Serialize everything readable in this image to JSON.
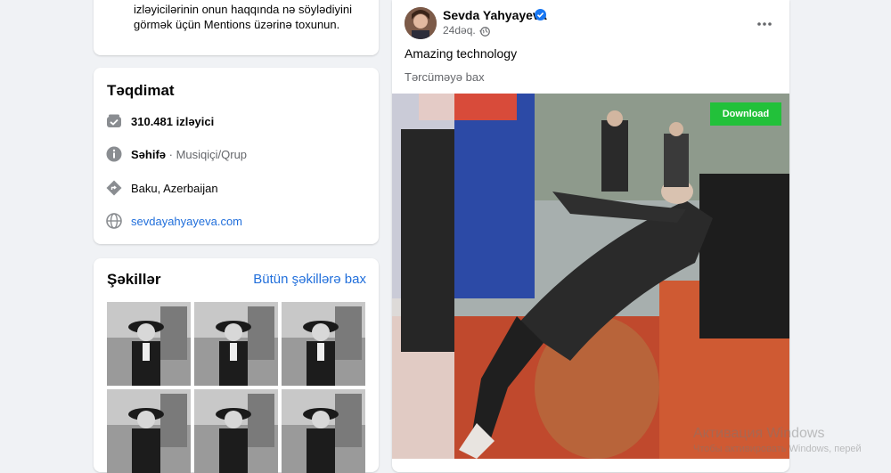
{
  "mentions": {
    "text": "izləyicilərinin onun haqqında nə söylədiyini görmək üçün Mentions üzərinə toxunun."
  },
  "intro": {
    "title": "Təqdimat",
    "followers": "310.481 izləyici",
    "page_label": "Səhifə",
    "page_category": " · Musiqiçi/Qrup",
    "location": "Baku, Azerbaijan",
    "website": "sevdayahyayeva.com"
  },
  "photos": {
    "title": "Şəkillər",
    "see_all": "Bütün şəkillərə bax"
  },
  "post": {
    "author": "Sevda Yahyayeva",
    "time": "24dəq. ·",
    "text": "Amazing technology",
    "translate": "Tərcüməyə bax",
    "download_label": "Download"
  },
  "watermark": {
    "title": "Активация Windows",
    "subtitle": "Чтобы активировать Windows, перей"
  },
  "colors": {
    "accent": "#216fdb",
    "background": "#f0f2f5",
    "download": "#22c13a",
    "verified": "#1877f2"
  }
}
